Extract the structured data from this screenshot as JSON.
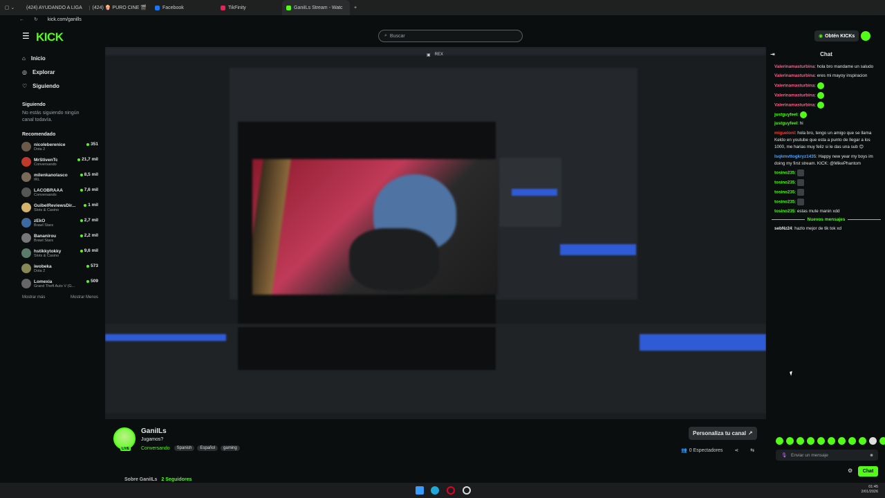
{
  "browser": {
    "tabs": [
      {
        "label": "(424) AYUDANDO A LIGA",
        "color": "#e4002b"
      },
      {
        "label": "(424) 🍿 PURO CINE 🎬",
        "color": "#e4002b"
      },
      {
        "label": "Facebook",
        "color": "#1877f2"
      },
      {
        "label": "TikFinity",
        "color": "#e0245e"
      },
      {
        "label": "GaniILs Stream - Watc",
        "color": "#53fc18"
      }
    ],
    "url": "kick.com/ganills"
  },
  "header": {
    "logo": "KICK",
    "search_placeholder": "Buscar",
    "kicks_button": "Obtén KICKs"
  },
  "sidebar": {
    "nav": [
      {
        "label": "Inicio",
        "icon": "home-icon"
      },
      {
        "label": "Explorar",
        "icon": "compass-icon"
      },
      {
        "label": "Siguiendo",
        "icon": "heart-icon"
      }
    ],
    "following_title": "Siguiendo",
    "following_empty": "No estás siguiendo ningún canal todavía.",
    "recommended_title": "Recomendado",
    "channels": [
      {
        "name": "nicoleberenice",
        "category": "Dota 2",
        "viewers": "351"
      },
      {
        "name": "MrStivenTc",
        "category": "Conversando",
        "viewers": "21,7 mil"
      },
      {
        "name": "milenkanolasco",
        "category": "IRL",
        "viewers": "8,5 mil"
      },
      {
        "name": "LACOBRAAA",
        "category": "Conversando",
        "viewers": "7,6 mil"
      },
      {
        "name": "GuibelReviewsDir...",
        "category": "Slots & Casino",
        "viewers": "1 mil"
      },
      {
        "name": "zEkO",
        "category": "Brawl Stars",
        "viewers": "2,7 mil"
      },
      {
        "name": "Bananirou",
        "category": "Brawl Stars",
        "viewers": "2,2 mil"
      },
      {
        "name": "hstikkytokky",
        "category": "Slots & Casino",
        "viewers": "9,6 mil"
      },
      {
        "name": "iwobeka",
        "category": "Dota 2",
        "viewers": "573"
      },
      {
        "name": "Lomexia",
        "category": "Grand Theft Auto V (G...",
        "viewers": "509"
      }
    ],
    "show_more": "Mostrar más",
    "show_less": "Mostrar Menos"
  },
  "chat": {
    "title": "Chat",
    "messages": [
      {
        "user": "Valerinamasturbina",
        "color": "#ff5e8a",
        "text": "hola bro mandame un saludo"
      },
      {
        "user": "Valerinamasturbina",
        "color": "#ff5e8a",
        "text": "eres mi mayoy inspiracion"
      },
      {
        "user": "Valerinamasturbina",
        "color": "#ff5e8a",
        "text": "",
        "emote": "green"
      },
      {
        "user": "Valerinamasturbina",
        "color": "#ff5e8a",
        "text": "",
        "emote": "green"
      },
      {
        "user": "Valerinamasturbina",
        "color": "#ff5e8a",
        "text": "",
        "emote": "green"
      },
      {
        "user": "justguyfeel",
        "color": "#53fc18",
        "text": "",
        "emote": "green"
      },
      {
        "user": "justguyfeel",
        "color": "#53fc18",
        "text": "hi"
      },
      {
        "user": "miguelonl",
        "color": "#ff3b3b",
        "text": "hola bro, tengo un amigo que se llama Keldo en youtube que esta a punto de llegar a los 1000, me harias muy feliz si le das una sub 😊"
      },
      {
        "user": "Isqkmvttogkryz1435",
        "color": "#4da3ff",
        "text": "Happy new year my boys im doing my first stream. KICK: @MikePhantom"
      },
      {
        "user": "tosino235",
        "color": "#53fc18",
        "text": "",
        "emote": "dark"
      },
      {
        "user": "tosino235",
        "color": "#53fc18",
        "text": "",
        "emote": "dark"
      },
      {
        "user": "tosino235",
        "color": "#53fc18",
        "text": "",
        "emote": "dark"
      },
      {
        "user": "tosino235",
        "color": "#53fc18",
        "text": "",
        "emote": "dark"
      },
      {
        "user": "tosino235",
        "color": "#53fc18",
        "text": "estas mute manin xdd"
      }
    ],
    "new_messages": "Nuevos mensajes",
    "after_messages": [
      {
        "user": "sebNz24",
        "color": "#e6e7e8",
        "text": "hazlo mejor de tik tok xd"
      }
    ],
    "input_placeholder": "Enviar un mensaje",
    "send_button": "Chat"
  },
  "stream": {
    "channel": "GaniILs",
    "title": "Jugamos?",
    "category": "Conversando",
    "tags": [
      "Spanish",
      "Español",
      "gaming"
    ],
    "live_badge": "LIVE",
    "customize_button": "Personaliza tu canal",
    "viewers": "0 Espectadores",
    "about": "Sobre GaniILs",
    "followers": "2 Seguidores",
    "overlay_label": "REX"
  },
  "taskbar": {
    "time": "01:45",
    "date": "2/01/2026",
    "lang": "ESP\nLAA"
  }
}
